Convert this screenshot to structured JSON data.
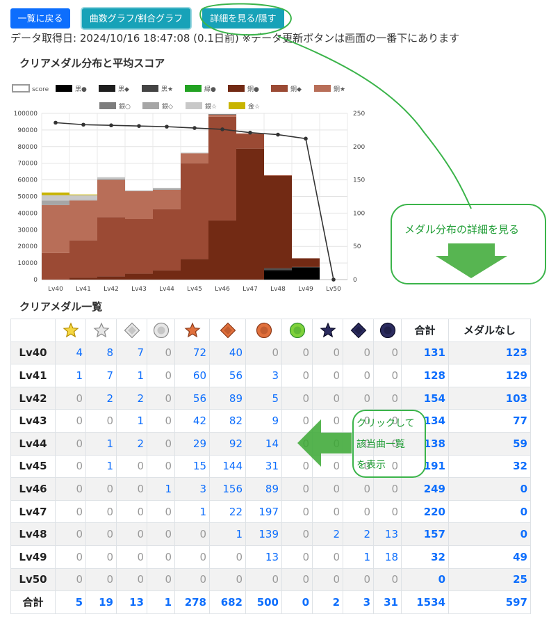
{
  "buttons": {
    "back": "一覧に戻る",
    "graph_toggle": "曲数グラフ/割合グラフ",
    "detail_toggle": "詳細を見る/隠す"
  },
  "info_line": "データ取得日: 2024/10/16 18:47:08 (0.1日前) ※データ更新ボタンは画面の一番下にあります",
  "chart_section_title": "クリアメダル分布と平均スコア",
  "list_section_title": "クリアメダル一覧",
  "chart_data": {
    "type": "bar",
    "stacked": true,
    "legend_position": "top",
    "grid": true,
    "categories": [
      "Lv40",
      "Lv41",
      "Lv42",
      "Lv43",
      "Lv44",
      "Lv45",
      "Lv46",
      "Lv47",
      "Lv48",
      "Lv49",
      "Lv50"
    ],
    "y_left": {
      "min": 0,
      "max": 100000,
      "ticks": [
        "0",
        "10000",
        "20000",
        "30000",
        "40000",
        "50000",
        "60000",
        "70000",
        "80000",
        "90000",
        "100000"
      ]
    },
    "y_right": {
      "min": 0,
      "max": 250,
      "ticks": [
        "0",
        "50",
        "100",
        "150",
        "200",
        "250"
      ]
    },
    "series": [
      {
        "name": "黒●",
        "color": "#000000",
        "values": [
          0,
          0,
          0,
          0,
          0,
          0,
          0,
          0,
          13,
          18,
          0
        ]
      },
      {
        "name": "黒◆",
        "color": "#1e1e1e",
        "values": [
          0,
          0,
          0,
          0,
          0,
          0,
          0,
          0,
          2,
          1,
          0
        ]
      },
      {
        "name": "黒★",
        "color": "#444444",
        "values": [
          0,
          0,
          0,
          0,
          0,
          0,
          0,
          0,
          2,
          0,
          0
        ]
      },
      {
        "name": "緑●",
        "color": "#22a222",
        "values": [
          0,
          0,
          0,
          0,
          0,
          0,
          0,
          0,
          0,
          0,
          0
        ]
      },
      {
        "name": "銅●",
        "color": "#722a14",
        "values": [
          0,
          3,
          5,
          9,
          14,
          31,
          89,
          197,
          139,
          13,
          0
        ]
      },
      {
        "name": "銅◆",
        "color": "#9b4a34",
        "values": [
          40,
          56,
          89,
          82,
          92,
          144,
          156,
          22,
          1,
          0,
          0
        ]
      },
      {
        "name": "銅★",
        "color": "#b86e58",
        "values": [
          72,
          60,
          56,
          42,
          29,
          15,
          3,
          1,
          0,
          0,
          0
        ]
      },
      {
        "name": "銀○",
        "color": "#7d7d7d",
        "values": [
          0,
          0,
          0,
          0,
          0,
          0,
          1,
          0,
          0,
          0,
          0
        ]
      },
      {
        "name": "銀◇",
        "color": "#a6a6a6",
        "values": [
          7,
          1,
          2,
          1,
          2,
          0,
          0,
          0,
          0,
          0,
          0
        ]
      },
      {
        "name": "銀☆",
        "color": "#c8c8c8",
        "values": [
          8,
          7,
          2,
          0,
          1,
          1,
          0,
          0,
          0,
          0,
          0
        ]
      },
      {
        "name": "金☆",
        "color": "#c8b400",
        "values": [
          4,
          1,
          0,
          0,
          0,
          0,
          0,
          0,
          0,
          0,
          0
        ]
      }
    ],
    "score_line": {
      "name": "score",
      "axis": "right",
      "values": [
        236,
        233,
        232,
        231,
        230,
        228,
        226,
        221,
        218,
        212,
        0
      ]
    }
  },
  "table": {
    "medal_icons": [
      "gold-star",
      "silver-star",
      "silver-diamond",
      "silver-circle",
      "bronze-star",
      "bronze-diamond",
      "bronze-circle",
      "green-circle",
      "black-star",
      "black-diamond",
      "black-circle"
    ],
    "total_header": "合計",
    "none_header": "メダルなし",
    "rows": [
      {
        "level": "Lv40",
        "counts": [
          "4",
          "8",
          "7",
          "0",
          "72",
          "40",
          "0",
          "0",
          "0",
          "0",
          "0"
        ],
        "total": "131",
        "none": "123"
      },
      {
        "level": "Lv41",
        "counts": [
          "1",
          "7",
          "1",
          "0",
          "60",
          "56",
          "3",
          "0",
          "0",
          "0",
          "0"
        ],
        "total": "128",
        "none": "129"
      },
      {
        "level": "Lv42",
        "counts": [
          "0",
          "2",
          "2",
          "0",
          "56",
          "89",
          "5",
          "0",
          "0",
          "0",
          "0"
        ],
        "total": "154",
        "none": "103"
      },
      {
        "level": "Lv43",
        "counts": [
          "0",
          "0",
          "1",
          "0",
          "42",
          "82",
          "9",
          "0",
          "0",
          "0",
          "0"
        ],
        "total": "134",
        "none": "77"
      },
      {
        "level": "Lv44",
        "counts": [
          "0",
          "1",
          "2",
          "0",
          "29",
          "92",
          "14",
          "0",
          "0",
          "0",
          "0"
        ],
        "total": "138",
        "none": "59"
      },
      {
        "level": "Lv45",
        "counts": [
          "0",
          "1",
          "0",
          "0",
          "15",
          "144",
          "31",
          "0",
          "0",
          "0",
          "0"
        ],
        "total": "191",
        "none": "32"
      },
      {
        "level": "Lv46",
        "counts": [
          "0",
          "0",
          "0",
          "1",
          "3",
          "156",
          "89",
          "0",
          "0",
          "0",
          "0"
        ],
        "total": "249",
        "none": "0"
      },
      {
        "level": "Lv47",
        "counts": [
          "0",
          "0",
          "0",
          "0",
          "1",
          "22",
          "197",
          "0",
          "0",
          "0",
          "0"
        ],
        "total": "220",
        "none": "0"
      },
      {
        "level": "Lv48",
        "counts": [
          "0",
          "0",
          "0",
          "0",
          "0",
          "1",
          "139",
          "0",
          "2",
          "2",
          "13"
        ],
        "total": "157",
        "none": "0"
      },
      {
        "level": "Lv49",
        "counts": [
          "0",
          "0",
          "0",
          "0",
          "0",
          "0",
          "13",
          "0",
          "0",
          "1",
          "18"
        ],
        "total": "32",
        "none": "49"
      },
      {
        "level": "Lv50",
        "counts": [
          "0",
          "0",
          "0",
          "0",
          "0",
          "0",
          "0",
          "0",
          "0",
          "0",
          "0"
        ],
        "total": "0",
        "none": "25"
      }
    ],
    "footer": {
      "label": "合計",
      "counts": [
        "5",
        "19",
        "13",
        "1",
        "278",
        "682",
        "500",
        "0",
        "2",
        "3",
        "31"
      ],
      "total": "1534",
      "none": "597"
    }
  },
  "callouts": {
    "chart_callout": "メダル分布の詳細を見る",
    "table_callout": [
      "クリックして",
      "該当曲一覧",
      "を表示"
    ]
  },
  "colors": {
    "primary": "#0d6efd",
    "info": "#17a2b8",
    "callout_green": "#1f9d35"
  }
}
